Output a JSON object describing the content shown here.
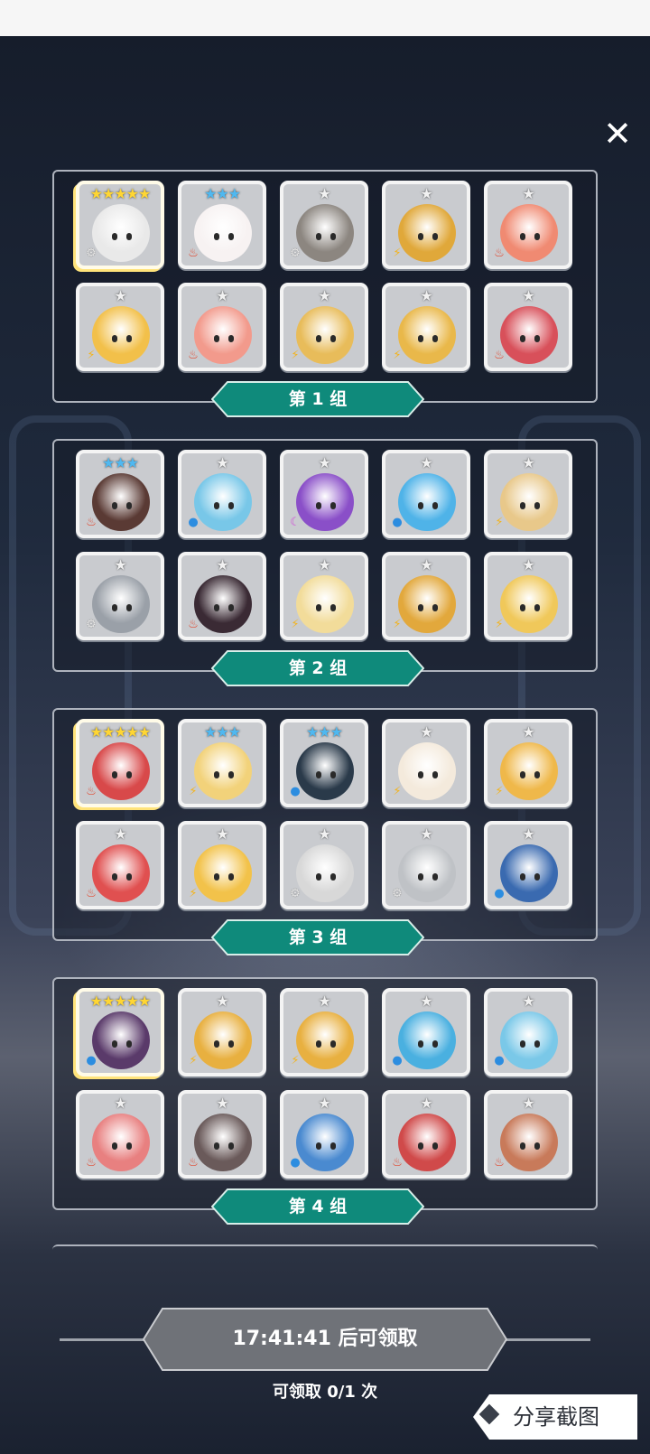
{
  "close_label": "✕",
  "groups": [
    {
      "label": "第 1 组",
      "heroes": [
        {
          "stars": "★★★★★",
          "tier": "s5",
          "element": "gear",
          "glyph": "⚙",
          "color": "#e9e9e9"
        },
        {
          "stars": "★★★",
          "tier": "s3",
          "element": "fire",
          "glyph": "♨",
          "color": "#f7f2f2"
        },
        {
          "stars": "★",
          "tier": "s1",
          "element": "gear",
          "glyph": "⚙",
          "color": "#8c8680"
        },
        {
          "stars": "★",
          "tier": "s1",
          "element": "light",
          "glyph": "⚡",
          "color": "#e0a83a"
        },
        {
          "stars": "★",
          "tier": "s1",
          "element": "fire",
          "glyph": "♨",
          "color": "#f08a72"
        },
        {
          "stars": "★",
          "tier": "s1",
          "element": "light",
          "glyph": "⚡",
          "color": "#f2c04a"
        },
        {
          "stars": "★",
          "tier": "s1",
          "element": "fire",
          "glyph": "♨",
          "color": "#f29a8c"
        },
        {
          "stars": "★",
          "tier": "s1",
          "element": "light",
          "glyph": "⚡",
          "color": "#e8bc5a"
        },
        {
          "stars": "★",
          "tier": "s1",
          "element": "light",
          "glyph": "⚡",
          "color": "#e9b84a"
        },
        {
          "stars": "★",
          "tier": "s1",
          "element": "fire",
          "glyph": "♨",
          "color": "#d8505a"
        }
      ]
    },
    {
      "label": "第 2 组",
      "heroes": [
        {
          "stars": "★★★",
          "tier": "s3",
          "element": "fire",
          "glyph": "♨",
          "color": "#5a3a34"
        },
        {
          "stars": "★",
          "tier": "s1",
          "element": "water",
          "glyph": "●",
          "color": "#78c7e8"
        },
        {
          "stars": "★",
          "tier": "s1",
          "element": "moon",
          "glyph": "☾",
          "color": "#8a4fc8"
        },
        {
          "stars": "★",
          "tier": "s1",
          "element": "water",
          "glyph": "●",
          "color": "#4fb3e8"
        },
        {
          "stars": "★",
          "tier": "s1",
          "element": "light",
          "glyph": "⚡",
          "color": "#e8c88a"
        },
        {
          "stars": "★",
          "tier": "s1",
          "element": "gear",
          "glyph": "⚙",
          "color": "#9aa0a8"
        },
        {
          "stars": "★",
          "tier": "s1",
          "element": "fire",
          "glyph": "♨",
          "color": "#3a2a34"
        },
        {
          "stars": "★",
          "tier": "s1",
          "element": "light",
          "glyph": "⚡",
          "color": "#f2dc9a"
        },
        {
          "stars": "★",
          "tier": "s1",
          "element": "light",
          "glyph": "⚡",
          "color": "#e2a83c"
        },
        {
          "stars": "★",
          "tier": "s1",
          "element": "light",
          "glyph": "⚡",
          "color": "#f0c85a"
        }
      ]
    },
    {
      "label": "第 3 组",
      "heroes": [
        {
          "stars": "★★★★★",
          "tier": "s5",
          "element": "fire",
          "glyph": "♨",
          "color": "#d8494a"
        },
        {
          "stars": "★★★",
          "tier": "s3",
          "element": "light",
          "glyph": "⚡",
          "color": "#f2d27a"
        },
        {
          "stars": "★★★",
          "tier": "s3",
          "element": "water",
          "glyph": "●",
          "color": "#2a3a4a"
        },
        {
          "stars": "★",
          "tier": "s1",
          "element": "light",
          "glyph": "⚡",
          "color": "#f4eadc"
        },
        {
          "stars": "★",
          "tier": "s1",
          "element": "light",
          "glyph": "⚡",
          "color": "#efb84a"
        },
        {
          "stars": "★",
          "tier": "s1",
          "element": "fire",
          "glyph": "♨",
          "color": "#e05050"
        },
        {
          "stars": "★",
          "tier": "s1",
          "element": "light",
          "glyph": "⚡",
          "color": "#f2c24a"
        },
        {
          "stars": "★",
          "tier": "s1",
          "element": "gear",
          "glyph": "⚙",
          "color": "#d8d8d8"
        },
        {
          "stars": "★",
          "tier": "s1",
          "element": "gear",
          "glyph": "⚙",
          "color": "#bfc2c6"
        },
        {
          "stars": "★",
          "tier": "s1",
          "element": "water",
          "glyph": "●",
          "color": "#3a6ab0"
        }
      ]
    },
    {
      "label": "第 4 组",
      "heroes": [
        {
          "stars": "★★★★★",
          "tier": "s5",
          "element": "water",
          "glyph": "●",
          "color": "#5a3a6a"
        },
        {
          "stars": "★",
          "tier": "s1",
          "element": "light",
          "glyph": "⚡",
          "color": "#e8b040"
        },
        {
          "stars": "★",
          "tier": "s1",
          "element": "light",
          "glyph": "⚡",
          "color": "#e8b040"
        },
        {
          "stars": "★",
          "tier": "s1",
          "element": "water",
          "glyph": "●",
          "color": "#4ab0e0"
        },
        {
          "stars": "★",
          "tier": "s1",
          "element": "water",
          "glyph": "●",
          "color": "#7ac8e8"
        },
        {
          "stars": "★",
          "tier": "s1",
          "element": "fire",
          "glyph": "♨",
          "color": "#e88080"
        },
        {
          "stars": "★",
          "tier": "s1",
          "element": "fire",
          "glyph": "♨",
          "color": "#6a5a5a"
        },
        {
          "stars": "★",
          "tier": "s1",
          "element": "water",
          "glyph": "●",
          "color": "#4a8ad0"
        },
        {
          "stars": "★",
          "tier": "s1",
          "element": "fire",
          "glyph": "♨",
          "color": "#d04a4a"
        },
        {
          "stars": "★",
          "tier": "s1",
          "element": "fire",
          "glyph": "♨",
          "color": "#c87a5a"
        }
      ]
    }
  ],
  "timer_text": "17:41:41 后可领取",
  "claims_text": "可领取 0/1 次",
  "share_label": "分享截图",
  "colors": {
    "ribbon": "#0f8a7b",
    "ribbon_edge": "#d8eee9",
    "timer": "#6f7278"
  }
}
